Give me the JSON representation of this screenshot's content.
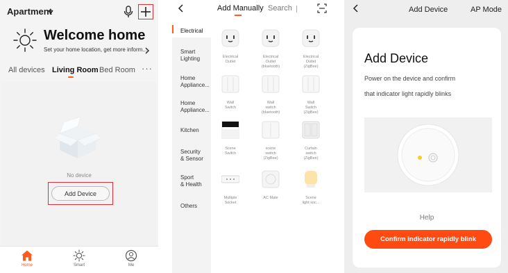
{
  "home": {
    "header": {
      "home_name": "Apartment"
    },
    "welcome": {
      "title": "Welcome home",
      "subtitle": "Set your home location, get more inform..."
    },
    "tabs": [
      "All devices",
      "Living Room",
      "Bed Room"
    ],
    "more": "···",
    "empty": {
      "message": "No device",
      "button": "Add Device"
    },
    "nav": [
      "Home",
      "Smart",
      "Me"
    ]
  },
  "add_manually": {
    "tabs": {
      "manual": "Add Manually",
      "search": "Search"
    },
    "categories": [
      [
        "Electrical"
      ],
      [
        "Smart",
        "Lighting"
      ],
      [
        "Home",
        "Appliance..."
      ],
      [
        "Home",
        "Appliance..."
      ],
      [
        "Kitchen"
      ],
      [
        "Security",
        "& Sensor"
      ],
      [
        "Sport",
        "& Health"
      ],
      [
        "Others"
      ]
    ],
    "devices": [
      [
        "Electrical",
        "Outlet"
      ],
      [
        "Electrical",
        "Outlet",
        "(bluetooth)"
      ],
      [
        "Electrical",
        "Outlet",
        "(ZigBee)"
      ],
      [
        "Wall",
        "Switch"
      ],
      [
        "Wall",
        "switch",
        "(bluetooth)"
      ],
      [
        "Wall",
        "Switch",
        "(ZigBee)"
      ],
      [
        "Scene",
        "Switch"
      ],
      [
        "scene",
        "switch",
        "(ZigBee)"
      ],
      [
        "Curtain",
        "switch",
        "(ZigBee)"
      ],
      [
        "Multiple",
        "Socket"
      ],
      [
        "AC Mate"
      ],
      [
        "Scene",
        "light soc..."
      ]
    ]
  },
  "add_device": {
    "header": {
      "title": "Add Device",
      "mode": "AP Mode"
    },
    "heading": "Add Device",
    "instructions": [
      "Power on the device and confirm",
      "that indicator light rapidly blinks"
    ],
    "help": "Help",
    "confirm_button": "Confirm indicator rapidly blink"
  },
  "colors": {
    "accent": "#ff4b12",
    "highlight": "#d9303a",
    "indicator": "#f5cd2a"
  },
  "icons": {
    "header": [
      "chevron-down-icon",
      "microphone-icon",
      "plus-icon",
      "sun-icon",
      "chevron-right-icon",
      "back-icon",
      "scan-icon"
    ],
    "nav": [
      "home-icon",
      "sun-icon",
      "smiley-icon"
    ],
    "devices": [
      "outlet-icon",
      "outlet-icon",
      "outlet-icon",
      "wall-switch-icon",
      "wall-switch-icon",
      "wall-switch-icon",
      "scene-switch-icon",
      "scene-switch-icon",
      "curtain-switch-icon",
      "power-strip-icon",
      "ac-mate-icon",
      "scene-light-icon"
    ],
    "illustration": [
      "device-indicator-illustration",
      "indicator-light-icon"
    ]
  }
}
